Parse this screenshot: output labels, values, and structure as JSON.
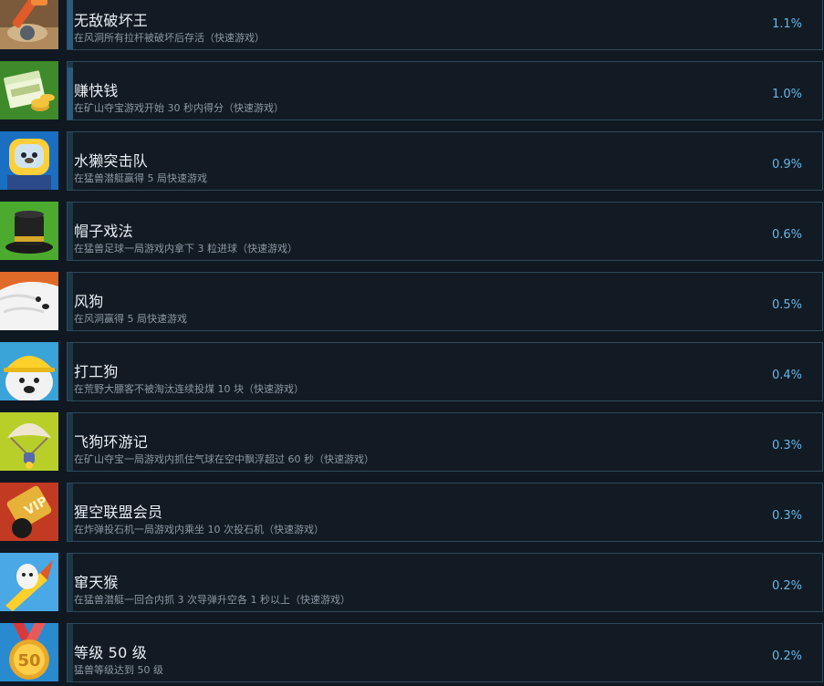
{
  "achievements": [
    {
      "title": "无敌破坏王",
      "description": "在风洞所有拉杆被破坏后存活（快速游戏）",
      "percent": "1.1%",
      "icon": "wrench-smash-icon",
      "progress": 0.9
    },
    {
      "title": "赚快钱",
      "description": "在矿山夺宝游戏开始 30 秒内得分（快速游戏）",
      "percent": "1.0%",
      "icon": "money-stack-icon",
      "progress": 0.9
    },
    {
      "title": "水獭突击队",
      "description": "在猛兽潜艇赢得 5 局快速游戏",
      "percent": "0.9%",
      "icon": "otter-diver-icon",
      "progress": 0
    },
    {
      "title": "帽子戏法",
      "description": "在猛兽足球一局游戏内拿下 3 粒进球（快速游戏）",
      "percent": "0.6%",
      "icon": "top-hat-icon",
      "progress": 0
    },
    {
      "title": "风狗",
      "description": "在风洞赢得 5 局快速游戏",
      "percent": "0.5%",
      "icon": "windy-dog-icon",
      "progress": 0
    },
    {
      "title": "打工狗",
      "description": "在荒野大膘客不被淘汰连续投煤 10 块（快速游戏）",
      "percent": "0.4%",
      "icon": "hardhat-dog-icon",
      "progress": 0
    },
    {
      "title": "飞狗环游记",
      "description": "在矿山夺宝一局游戏内抓住气球在空中飘浮超过 60 秒（快速游戏）",
      "percent": "0.3%",
      "icon": "balloon-icon",
      "progress": 0
    },
    {
      "title": "猩空联盟会员",
      "description": "在炸弹投石机一局游戏内乘坐 10 次投石机（快速游戏）",
      "percent": "0.3%",
      "icon": "vip-ticket-icon",
      "progress": 0
    },
    {
      "title": "窜天猴",
      "description": "在猛兽潜艇一回合内抓 3 次导弹升空各 1 秒以上（快速游戏）",
      "percent": "0.2%",
      "icon": "rocket-monkey-icon",
      "progress": 0
    },
    {
      "title": "等级 50 级",
      "description": "猛兽等级达到 50 级",
      "percent": "0.2%",
      "icon": "level-50-medal-icon",
      "progress": 0
    }
  ],
  "medal_text": "50",
  "colors": {
    "background": "#101822",
    "panel": "#121b24",
    "panel_border": "#2c4a5d",
    "title": "#e8eef2",
    "description": "#8b98a3",
    "percent": "#67b6e8"
  }
}
